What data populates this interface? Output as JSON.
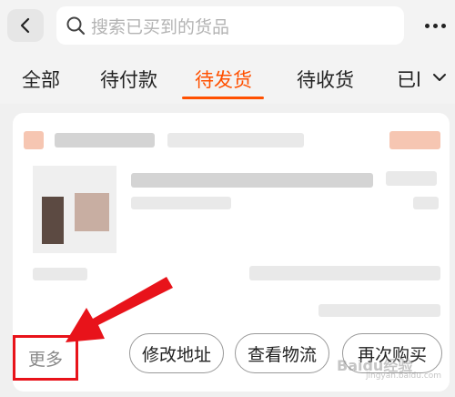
{
  "header": {
    "search_placeholder": "搜索已买到的货品"
  },
  "tabs": [
    {
      "label": "全部",
      "active": false
    },
    {
      "label": "待付款",
      "active": false
    },
    {
      "label": "待发货",
      "active": true
    },
    {
      "label": "待收货",
      "active": false
    },
    {
      "label": "已l",
      "active": false
    }
  ],
  "order_actions": {
    "more_label": "更多",
    "buttons": [
      {
        "label": "修改地址"
      },
      {
        "label": "查看物流"
      },
      {
        "label": "再次购买"
      }
    ]
  },
  "watermark": {
    "text": "Baidu经验",
    "sub": "jingyan.baidu.com"
  },
  "colors": {
    "accent": "#ff5000",
    "annotation": "#e8131a"
  }
}
